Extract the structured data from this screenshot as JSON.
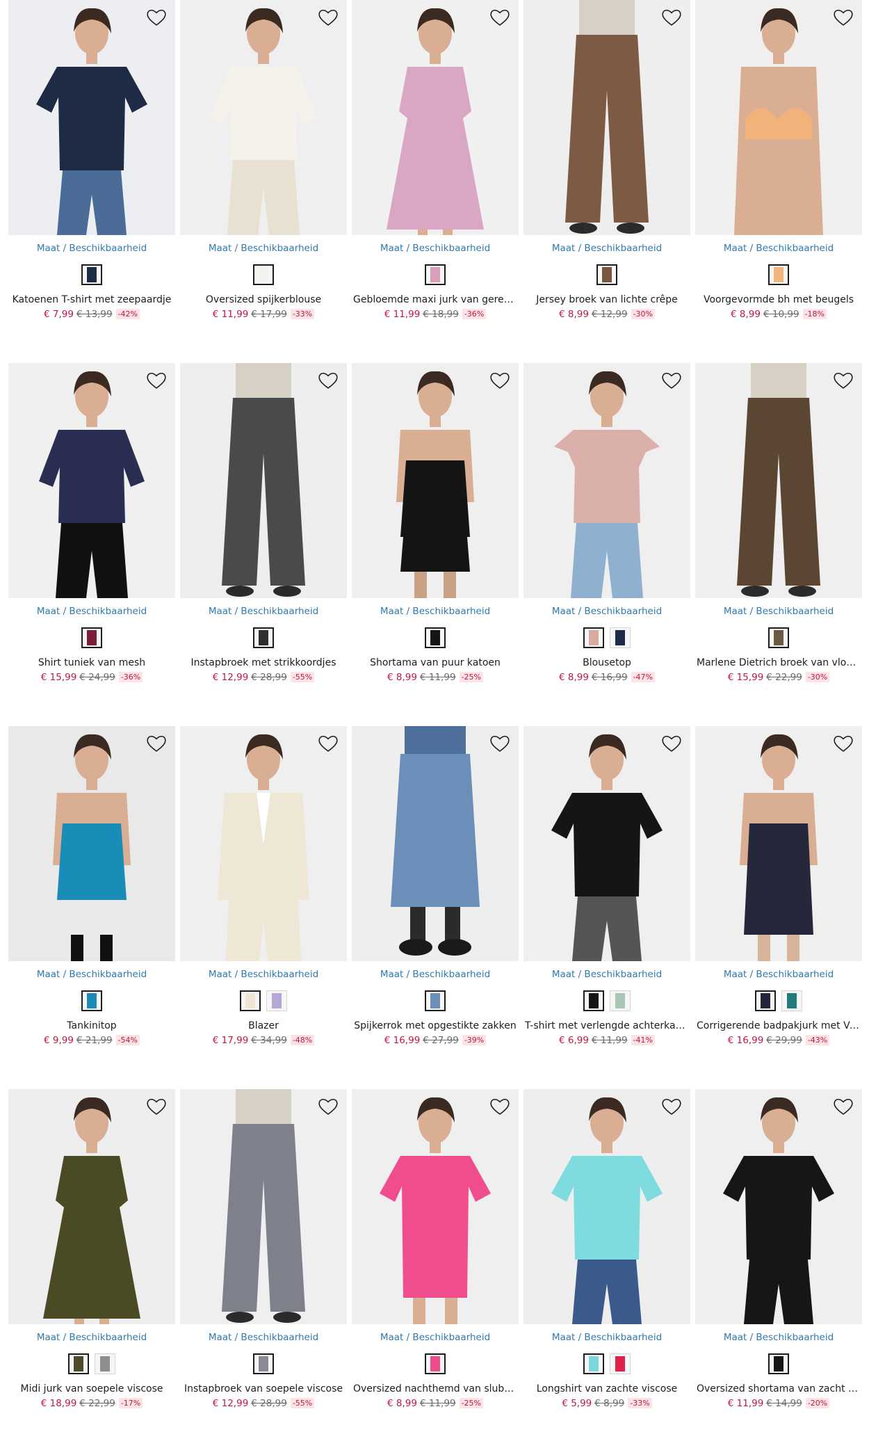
{
  "colors": {
    "accent_blue": "#2f7ab0",
    "price_red": "#c01842",
    "discount_bg": "#fbe3e6"
  },
  "availability_label": "Maat / Beschikbaarheid",
  "wishlist_icon": "heart-outline-icon",
  "products": [
    {
      "name": "Katoenen T-shirt met zeepaardje",
      "price": "€ 7,99",
      "old_price": "€ 13,99",
      "discount": "-42%",
      "swatches": [
        "#1e2b45"
      ],
      "garment": "tee",
      "color": "#1e2b45",
      "bg": "#eceef1",
      "legs": "#4a6c96"
    },
    {
      "name": "Oversized spijkerblouse",
      "price": "€ 11,99",
      "old_price": "€ 17,99",
      "discount": "-33%",
      "swatches": [
        "#f4f2ec"
      ],
      "garment": "blouse",
      "color": "#f4f2ea",
      "bg": "#efefef",
      "legs": "#e8e0d0"
    },
    {
      "name": "Gebloemde maxi jurk van gerecycle...",
      "price": "€ 11,99",
      "old_price": "€ 18,99",
      "discount": "-36%",
      "swatches": [
        "#d8a0b8"
      ],
      "garment": "dress",
      "color": "#d9a7c4",
      "bg": "#f1f0f0",
      "legs": "#e8c8a8"
    },
    {
      "name": "Jersey broek van lichte crêpe",
      "price": "€ 8,99",
      "old_price": "€ 12,99",
      "discount": "-30%",
      "swatches": [
        "#7a5540"
      ],
      "garment": "pants",
      "color": "#7c5a44",
      "bg": "#eeeeee",
      "legs": "#7c5a44"
    },
    {
      "name": "Voorgevormde bh met beugels",
      "price": "€ 8,99",
      "old_price": "€ 10,99",
      "discount": "-18%",
      "swatches": [
        "#f2b680"
      ],
      "garment": "bra",
      "color": "#f2b27a",
      "bg": "#f1efed",
      "legs": "#d9a888"
    },
    {
      "name": "Shirt tuniek van mesh",
      "price": "€ 15,99",
      "old_price": "€ 24,99",
      "discount": "-36%",
      "swatches": [
        "#7a1e3a"
      ],
      "garment": "tunic",
      "color": "#2a2e52",
      "bg": "#f0f0f0",
      "legs": "#111111"
    },
    {
      "name": "Instapbroek met strikkoordjes",
      "price": "€ 12,99",
      "old_price": "€ 28,99",
      "discount": "-55%",
      "swatches": [
        "#2f2f2f"
      ],
      "garment": "pants",
      "color": "#4a4a4a",
      "bg": "#eeeeee",
      "legs": "#4a4a4a"
    },
    {
      "name": "Shortama van puur katoen",
      "price": "€ 8,99",
      "old_price": "€ 11,99",
      "discount": "-25%",
      "swatches": [
        "#151515"
      ],
      "garment": "cami",
      "color": "#141414",
      "bg": "#efefef",
      "legs": "#c9a285"
    },
    {
      "name": "Blousetop",
      "price": "€ 8,99",
      "old_price": "€ 16,99",
      "discount": "-47%",
      "swatches": [
        "#d9aaa2",
        "#1e2a4a"
      ],
      "garment": "top",
      "color": "#dcb0aa",
      "bg": "#efefef",
      "legs": "#8fb0cf"
    },
    {
      "name": "Marlene Dietrich broek van vloeien...",
      "price": "€ 15,99",
      "old_price": "€ 22,99",
      "discount": "-30%",
      "swatches": [
        "#6a5a3e"
      ],
      "garment": "pants",
      "color": "#5a4632",
      "bg": "#efefef",
      "legs": "#5a4632"
    },
    {
      "name": "Tankinitop",
      "price": "€ 9,99",
      "old_price": "€ 21,99",
      "discount": "-54%",
      "swatches": [
        "#1b8ab8"
      ],
      "garment": "swim",
      "color": "#1a8cb8",
      "bg": "#e9e9e9",
      "legs": "#111111"
    },
    {
      "name": "Blazer",
      "price": "€ 17,99",
      "old_price": "€ 34,99",
      "discount": "-48%",
      "swatches": [
        "#efe6d4",
        "#b7a7d6"
      ],
      "garment": "blazer",
      "color": "#efe7d6",
      "bg": "#efefef",
      "legs": "#efe7d6"
    },
    {
      "name": "Spijkerrok met opgestikte zakken",
      "price": "€ 16,99",
      "old_price": "€ 27,99",
      "discount": "-39%",
      "swatches": [
        "#6b8fb8"
      ],
      "garment": "skirt",
      "color": "#6c8fba",
      "bg": "#eeeeee",
      "legs": "#2b2b2b"
    },
    {
      "name": "T-shirt met verlengde achterkant v...",
      "price": "€ 6,99",
      "old_price": "€ 11,99",
      "discount": "-41%",
      "swatches": [
        "#151515",
        "#a7c7b4"
      ],
      "garment": "tee",
      "color": "#151515",
      "bg": "#efefef",
      "legs": "#555555"
    },
    {
      "name": "Corrigerende badpakjurk met V-hal...",
      "price": "€ 16,99",
      "old_price": "€ 29,99",
      "discount": "-43%",
      "swatches": [
        "#23263a",
        "#1f7c7a"
      ],
      "garment": "swimdress",
      "color": "#25283a",
      "bg": "#efefef",
      "legs": "#d8b49a"
    },
    {
      "name": "Midi jurk van soepele viscose",
      "price": "€ 18,99",
      "old_price": "€ 22,99",
      "discount": "-17%",
      "swatches": [
        "#4d4d2b",
        "#8e8e8e"
      ],
      "garment": "dress",
      "color": "#4a4a24",
      "bg": "#eeeeee",
      "legs": "#d8b49a"
    },
    {
      "name": "Instapbroek van soepele viscose",
      "price": "€ 12,99",
      "old_price": "€ 28,99",
      "discount": "-55%",
      "swatches": [
        "#8a8a96"
      ],
      "garment": "pants",
      "color": "#7e808c",
      "bg": "#efefef",
      "legs": "#7e808c"
    },
    {
      "name": "Oversized nachthemd van slubgaren",
      "price": "€ 8,99",
      "old_price": "€ 11,99",
      "discount": "-25%",
      "swatches": [
        "#f04c8c"
      ],
      "garment": "nightdress",
      "color": "#f04d8e",
      "bg": "#efefef",
      "legs": "#d8b49a"
    },
    {
      "name": "Longshirt van zachte viscose",
      "price": "€ 5,99",
      "old_price": "€ 8,99",
      "discount": "-33%",
      "swatches": [
        "#7ad8dc",
        "#e0204a"
      ],
      "garment": "tee",
      "color": "#7fdcde",
      "bg": "#eeeeee",
      "legs": "#3b5a8c"
    },
    {
      "name": "Oversized shortama van zacht modal",
      "price": "€ 11,99",
      "old_price": "€ 14,99",
      "discount": "-20%",
      "swatches": [
        "#151515"
      ],
      "garment": "tee",
      "color": "#161616",
      "bg": "#efefef",
      "legs": "#161616"
    }
  ]
}
